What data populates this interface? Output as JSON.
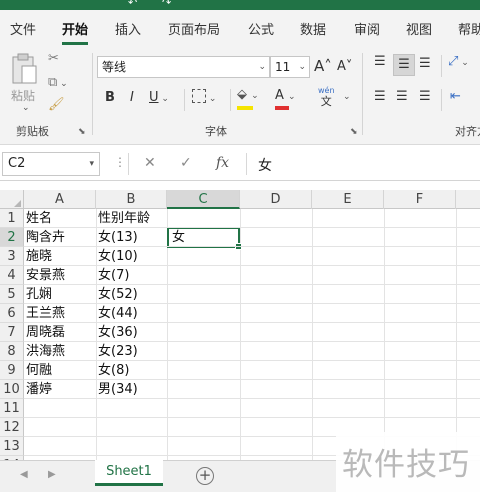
{
  "ribbon_tabs": [
    "文件",
    "开始",
    "插入",
    "页面布局",
    "公式",
    "数据",
    "审阅",
    "视图",
    "帮助"
  ],
  "active_tab": "开始",
  "clipboard": {
    "paste_label": "粘贴",
    "group_label": "剪贴板"
  },
  "font": {
    "name": "等线",
    "size": "11",
    "grow": "A˄",
    "shrink": "A˅",
    "bold": "B",
    "italic": "I",
    "underline": "U",
    "color_a": "A",
    "phonetic_top": "wén",
    "phonetic_bottom": "文",
    "group_label": "字体"
  },
  "alignment": {
    "group_label": "对齐方"
  },
  "formula_bar": {
    "name_box": "C2",
    "fx": "fx",
    "cancel": "✕",
    "confirm": "✓",
    "value": "女"
  },
  "columns": [
    "A",
    "B",
    "C",
    "D",
    "E",
    "F"
  ],
  "rows": [
    "1",
    "2",
    "3",
    "4",
    "5",
    "6",
    "7",
    "8",
    "9",
    "10",
    "11",
    "12",
    "13",
    "14"
  ],
  "cells": {
    "A": [
      "姓名",
      "陶含卉",
      "施晓",
      "安景燕",
      "孔娴",
      "王兰燕",
      "周晓磊",
      "洪海燕",
      "何融",
      "潘婷"
    ],
    "B": [
      "性别年龄",
      "女(13)",
      "女(10)",
      "女(7)",
      "女(52)",
      "女(44)",
      "女(36)",
      "女(23)",
      "女(8)",
      "男(34)"
    ],
    "C2": "女"
  },
  "selected_cell": "C2",
  "sheets": [
    "Sheet1"
  ],
  "add_sheet": "+",
  "watermark": "软件技巧",
  "colors": {
    "accent": "#217346",
    "font_color_bar": "#e03030",
    "highlight_bar": "#f5e400"
  }
}
